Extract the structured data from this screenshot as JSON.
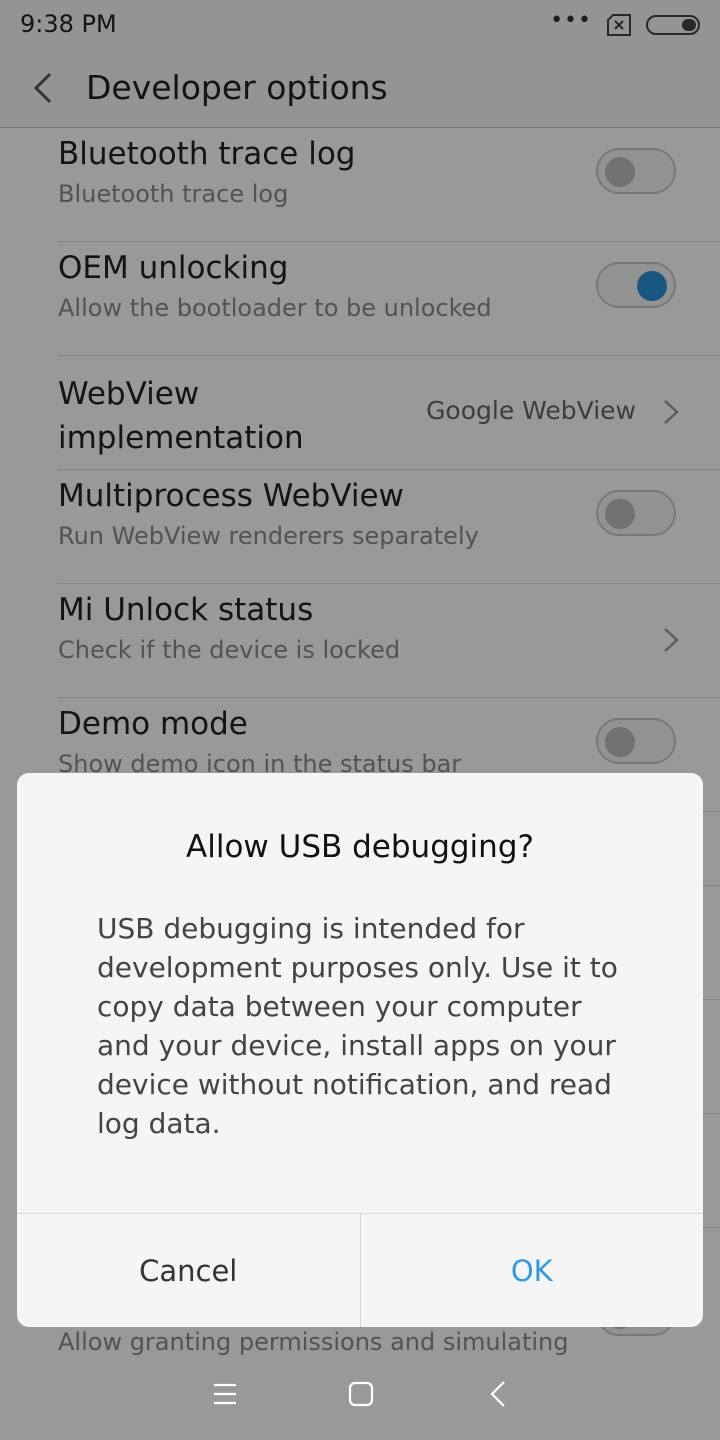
{
  "status_bar": {
    "time": "9:38 PM",
    "icons": [
      "more-dots-icon",
      "sim-x-icon",
      "battery-icon"
    ]
  },
  "header": {
    "title": "Developer options",
    "back_icon": "chevron-left-icon"
  },
  "settings": [
    {
      "title": "Bluetooth trace log",
      "subtitle": "Bluetooth trace log",
      "control": "toggle",
      "on": false
    },
    {
      "title": "OEM unlocking",
      "subtitle": "Allow the bootloader to be unlocked",
      "control": "toggle",
      "on": true
    },
    {
      "title": "WebView implementation",
      "value": "Google WebView",
      "control": "chevron"
    },
    {
      "title": "Multiprocess WebView",
      "subtitle": "Run WebView renderers separately",
      "control": "toggle",
      "on": false
    },
    {
      "title": "Mi Unlock status",
      "subtitle": "Check if the device is locked",
      "control": "chevron"
    },
    {
      "title": "Demo mode",
      "subtitle": "Show demo icon in the status bar",
      "control": "toggle",
      "on": false
    }
  ],
  "partial_row_subtitle": "Allow granting permissions and simulating",
  "dialog": {
    "title": "Allow USB debugging?",
    "body": "USB debugging is intended for development purposes only. Use it to copy data between your computer and your device, install apps on your device without notification, and read log data.",
    "cancel_label": "Cancel",
    "ok_label": "OK"
  },
  "nav_bar": {
    "icons": [
      "menu-icon",
      "home-icon",
      "back-icon"
    ]
  },
  "colors": {
    "accent": "#2f9be6",
    "toggle_on": "#2a8fd8",
    "scrim": "rgba(0,0,0,0.40)"
  }
}
